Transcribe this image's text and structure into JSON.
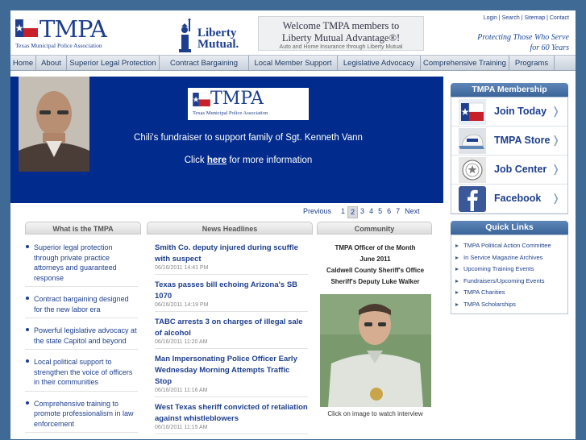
{
  "header": {
    "logo_word": "TMPA",
    "logo_sub": "Texas Municipal Police Association",
    "partner_line1": "Liberty",
    "partner_line2": "Mutual.",
    "welcome_line1": "Welcome TMPA members to",
    "welcome_line2": "Liberty Mutual Advantage®!",
    "welcome_line3": "Auto and Home Insurance through Liberty Mutual",
    "top_links": [
      "Login",
      "Search",
      "Sitemap",
      "Contact"
    ],
    "tagline_line1": "Protecting Those Who Serve",
    "tagline_line2": "for 60 Years"
  },
  "nav": [
    {
      "label": "Home"
    },
    {
      "label": "About"
    },
    {
      "label": "Superior Legal Protection"
    },
    {
      "label": "Contract Bargaining"
    },
    {
      "label": "Local Member Support"
    },
    {
      "label": "Legislative Advocacy"
    },
    {
      "label": "Comprehensive Training"
    },
    {
      "label": "Programs"
    }
  ],
  "hero": {
    "headline": "Chili's fundraiser to support family of Sgt. Kenneth Vann",
    "click_prefix": "Click ",
    "click_link": "here",
    "click_suffix": " for more information",
    "logo_word": "TMPA",
    "logo_sub": "Texas Municipal Police Association"
  },
  "pager": {
    "previous": "Previous",
    "pages": [
      "1",
      "2",
      "3",
      "4",
      "5",
      "6",
      "7"
    ],
    "current": "2",
    "next": "Next"
  },
  "tabs": {
    "what": "What is the TMPA",
    "news": "News Headlines",
    "community": "Community"
  },
  "what_items": [
    "Superior legal protection through private practice attorneys and guaranteed response",
    "Contract bargaining designed for the new labor era",
    "Powerful legislative advocacy at the state Capitol and beyond",
    "Local political support to strengthen the voice of officers in their communities",
    "Comprehensive training to promote professionalism in law enforcement"
  ],
  "news": [
    {
      "title": "Smith Co. deputy injured during scuffle with suspect",
      "time": "06/16/2011 14:41 PM"
    },
    {
      "title": "Texas passes bill echoing Arizona's SB 1070",
      "time": "06/16/2011 14:19 PM"
    },
    {
      "title": "TABC arrests 3 on charges of illegal sale of alcohol",
      "time": "06/16/2011 11:20 AM"
    },
    {
      "title": "Man Impersonating Police Officer Early Wednesday Morning Attempts Traffic Stop",
      "time": "06/16/2011 11:16 AM"
    },
    {
      "title": "West Texas sheriff convicted of retaliation against whistleblowers",
      "time": "06/16/2011 11:15 AM"
    }
  ],
  "community": {
    "line1": "TMPA Officer of the Month",
    "line2": "June 2011",
    "line3": "Caldwell County Sheriff's Office",
    "line4": "Sheriff's Deputy Luke Walker",
    "caption": "Click on image to watch interview"
  },
  "membership": {
    "title": "TMPA Membership",
    "items": [
      {
        "label": "Join Today",
        "icon": "texas-flag-icon"
      },
      {
        "label": "TMPA Store",
        "icon": "cap-icon"
      },
      {
        "label": "Job Center",
        "icon": "badge-icon"
      },
      {
        "label": "Facebook",
        "icon": "facebook-icon"
      }
    ],
    "chevron": "❭"
  },
  "quick_links": {
    "title": "Quick Links",
    "items": [
      "TMPA Political Action Committee",
      "In Service Magazine Archives",
      "Upcoming Training Events",
      "Fundraisers/Upcoming Events",
      "TMPA Charities",
      "TMPA Scholarships"
    ]
  },
  "colors": {
    "brand": "#1d3e8c",
    "hero_bg": "#012b8c",
    "page_bg": "#3f6a96"
  }
}
